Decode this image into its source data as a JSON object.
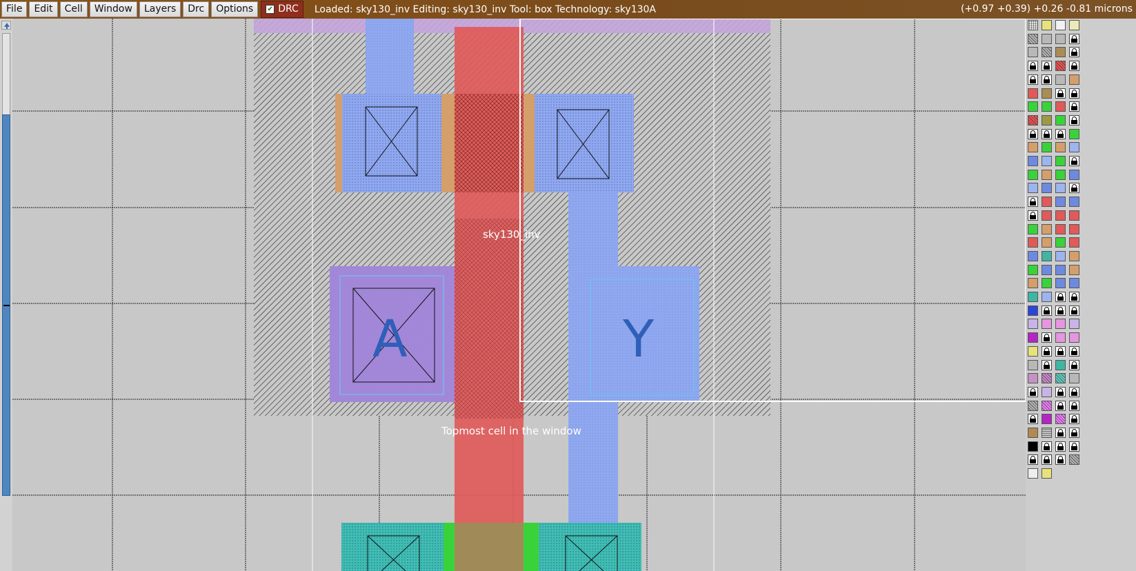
{
  "menu": {
    "items": [
      {
        "label": "File",
        "name": "menu-file"
      },
      {
        "label": "Edit",
        "name": "menu-edit"
      },
      {
        "label": "Cell",
        "name": "menu-cell"
      },
      {
        "label": "Window",
        "name": "menu-window"
      },
      {
        "label": "Layers",
        "name": "menu-layers"
      },
      {
        "label": "Drc",
        "name": "menu-drc"
      },
      {
        "label": "Options",
        "name": "menu-options"
      }
    ],
    "drc_toggle": {
      "label": "DRC",
      "checked": true
    }
  },
  "status": {
    "text": "Loaded: sky130_inv Editing: sky130_inv Tool: box  Technology: sky130A",
    "coords": "(+0.97 +0.39) +0.26 -0.81 microns"
  },
  "layout": {
    "cell_label": "sky130_inv",
    "window_label": "Topmost cell in the window",
    "port_a": "A",
    "port_y": "Y"
  },
  "colors": {
    "menubar": "#8a5216",
    "drc_button": "#8f2e1d",
    "poly": "#e05a5a",
    "locali": "#8fa8ef",
    "pdiff": "#d59f6b",
    "ndiff": "#3fbfae",
    "nwell": "#c8a8e0",
    "grid": "#202020",
    "box": "#ffffff"
  },
  "palette": {
    "rows": [
      [
        "dots",
        "yellow",
        "white",
        "ltyellow"
      ],
      [
        "grey-hatch",
        "grey",
        "grey",
        "lock"
      ],
      [
        "grey",
        "grey-hatch",
        "brown",
        "lock"
      ],
      [
        "lock",
        "lock",
        "red-hatch",
        "lock"
      ],
      [
        "lock",
        "lock",
        "grey",
        "tan"
      ],
      [
        "red",
        "brown",
        "lock",
        "lock"
      ],
      [
        "green",
        "green",
        "red",
        "lock"
      ],
      [
        "red-hatch",
        "olive",
        "green",
        "lock"
      ],
      [
        "lock",
        "lock",
        "lock",
        "green"
      ],
      [
        "tan",
        "green",
        "tan",
        "ltblue-x"
      ],
      [
        "blue-x",
        "ltblue-x",
        "green",
        "lock"
      ],
      [
        "green",
        "tan",
        "green",
        "blue-x"
      ],
      [
        "ltblue-x",
        "blue-x",
        "ltblue-x",
        "lock"
      ],
      [
        "lock",
        "red",
        "blue-x",
        "blue-x"
      ],
      [
        "lock",
        "red",
        "red",
        "red"
      ],
      [
        "green",
        "tan",
        "red",
        "red"
      ],
      [
        "red",
        "tan",
        "green",
        "red"
      ],
      [
        "blue-x",
        "teal-x",
        "ltblue-x",
        "tan"
      ],
      [
        "green",
        "blue-x",
        "blue-x",
        "tan"
      ],
      [
        "tan",
        "green",
        "blue-x",
        "blue-x"
      ],
      [
        "teal-x",
        "ltblue",
        "lock",
        "lock"
      ],
      [
        "blue-dots",
        "lock",
        "lock",
        "lock"
      ],
      [
        "lavender",
        "pink",
        "pink",
        "lavender"
      ],
      [
        "magenta",
        "lock",
        "pink",
        "pink"
      ],
      [
        "yellow",
        "lock",
        "lock",
        "lock"
      ],
      [
        "grey",
        "lock",
        "teal-x",
        "lock"
      ],
      [
        "mauve",
        "mauve-hatch",
        "teal",
        "grey"
      ],
      [
        "lock",
        "lavender",
        "lock",
        "lock"
      ],
      [
        "grey-hatch",
        "magenta-hatch",
        "lock",
        "lock"
      ],
      [
        "lock",
        "magenta",
        "magenta-hatch",
        "lock"
      ],
      [
        "brown-dots",
        "grey-lines",
        "lock",
        "lock"
      ],
      [
        "black",
        "lock",
        "lock",
        "lock"
      ],
      [
        "lock",
        "lock",
        "lock",
        "grey-hatch"
      ],
      [
        "white-dots",
        "yellow"
      ]
    ]
  }
}
